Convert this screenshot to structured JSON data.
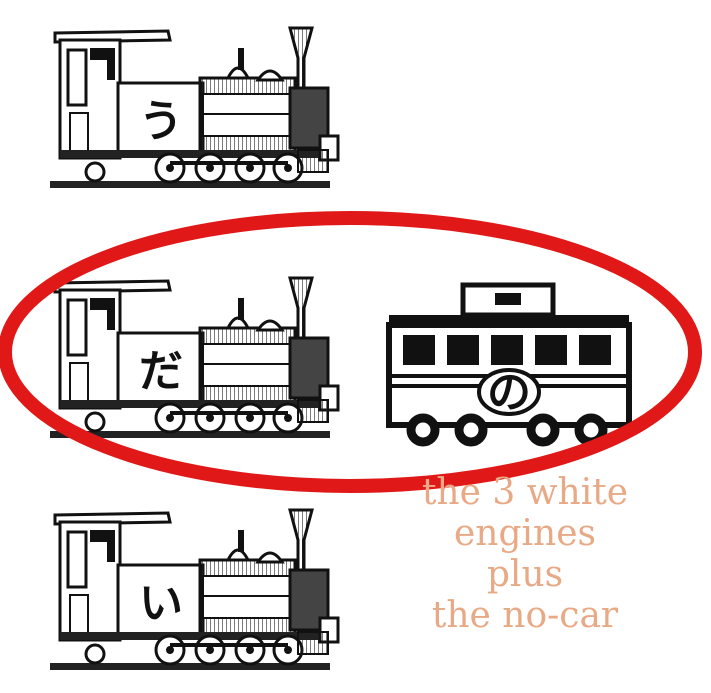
{
  "engines": [
    {
      "kana": "う"
    },
    {
      "kana": "だ"
    },
    {
      "kana": "い"
    }
  ],
  "car": {
    "kana": "の"
  },
  "caption": {
    "line1": "the 3 white",
    "line2": "engines",
    "line3": "plus",
    "line4": "the no-car"
  },
  "colors": {
    "highlight": "#e01818",
    "caption": "#e8aa86"
  }
}
